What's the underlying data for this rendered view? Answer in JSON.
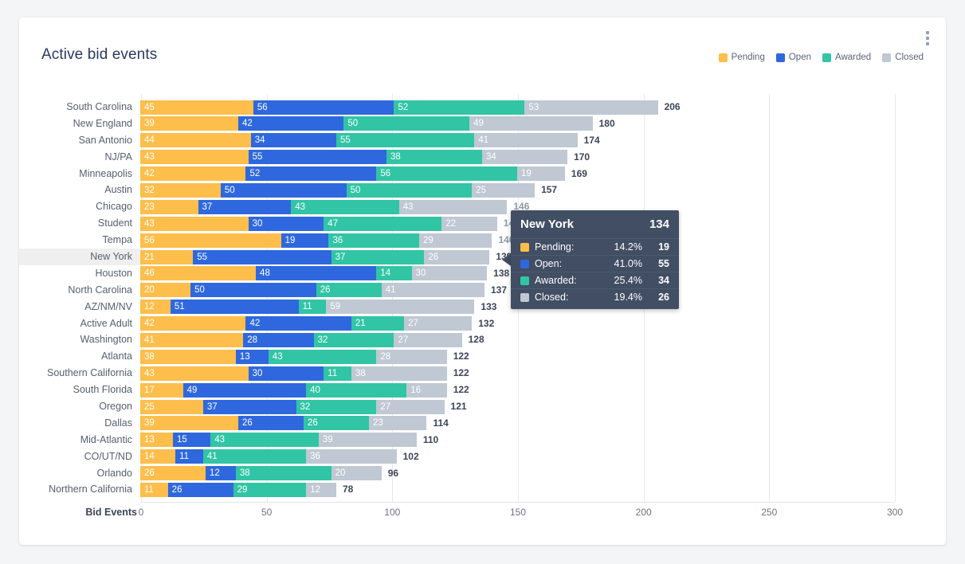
{
  "card": {
    "title": "Active bid events",
    "menu_icon": "kebab-menu-icon"
  },
  "legend": [
    {
      "label": "Pending",
      "color": "#fdbe4b"
    },
    {
      "label": "Open",
      "color": "#2f68de"
    },
    {
      "label": "Awarded",
      "color": "#31c5a5"
    },
    {
      "label": "Closed",
      "color": "#bfc8d3"
    }
  ],
  "tooltip": {
    "title": "New York",
    "total": "134",
    "rows": [
      {
        "name": "Pending:",
        "pct": "14.2%",
        "value": "19",
        "color": "#fdbe4b"
      },
      {
        "name": "Open:",
        "pct": "41.0%",
        "value": "55",
        "color": "#2f68de"
      },
      {
        "name": "Awarded:",
        "pct": "25.4%",
        "value": "34",
        "color": "#31c5a5"
      },
      {
        "name": "Closed:",
        "pct": "19.4%",
        "value": "26",
        "color": "#bfc8d3"
      }
    ]
  },
  "chart_data": {
    "type": "bar",
    "orientation": "horizontal",
    "stacked": true,
    "title": "Active bid events",
    "xlabel": "Bid Events",
    "ylabel": "",
    "xlim": [
      0,
      300
    ],
    "xticks": [
      "0",
      "50",
      "100",
      "150",
      "200",
      "250",
      "300"
    ],
    "grid": true,
    "legend_position": "top-right",
    "series": [
      {
        "name": "Pending",
        "color": "#fdbe4b"
      },
      {
        "name": "Open",
        "color": "#2f68de"
      },
      {
        "name": "Awarded",
        "color": "#31c5a5"
      },
      {
        "name": "Closed",
        "color": "#bfc8d3"
      }
    ],
    "categories": [
      "South Carolina",
      "New England",
      "San Antonio",
      "NJ/PA",
      "Minneapolis",
      "Austin",
      "Chicago",
      "Student",
      "Tempa",
      "New York",
      "Houston",
      "North Carolina",
      "AZ/NM/NV",
      "Active Adult",
      "Washington",
      "Atlanta",
      "Southern California",
      "South Florida",
      "Oregon",
      "Dallas",
      "Mid-Atlantic",
      "CO/UT/ND",
      "Orlando",
      "Northern California"
    ],
    "rows": [
      {
        "category": "South Carolina",
        "values": [
          45,
          56,
          52,
          53
        ],
        "total": "206",
        "highlight": false,
        "total_hidden": false
      },
      {
        "category": "New England",
        "values": [
          39,
          42,
          50,
          49
        ],
        "total": "180",
        "highlight": false,
        "total_hidden": false
      },
      {
        "category": "San Antonio",
        "values": [
          44,
          34,
          55,
          41
        ],
        "total": "174",
        "highlight": false,
        "total_hidden": false
      },
      {
        "category": "NJ/PA",
        "values": [
          43,
          55,
          38,
          34
        ],
        "total": "170",
        "highlight": false,
        "total_hidden": false
      },
      {
        "category": "Minneapolis",
        "values": [
          42,
          52,
          56,
          19
        ],
        "total": "169",
        "highlight": false,
        "total_hidden": false
      },
      {
        "category": "Austin",
        "values": [
          32,
          50,
          50,
          25
        ],
        "total": "157",
        "highlight": false,
        "total_hidden": false
      },
      {
        "category": "Chicago",
        "values": [
          23,
          37,
          43,
          43
        ],
        "total": "146",
        "highlight": false,
        "total_hidden": true
      },
      {
        "category": "Student",
        "values": [
          43,
          30,
          47,
          22
        ],
        "total": "142",
        "highlight": false,
        "total_hidden": true
      },
      {
        "category": "Tempa",
        "values": [
          56,
          19,
          36,
          29
        ],
        "total": "140",
        "highlight": false,
        "total_hidden": true
      },
      {
        "category": "New York",
        "values": [
          21,
          55,
          37,
          26
        ],
        "total": "139",
        "highlight": true,
        "total_hidden": false
      },
      {
        "category": "Houston",
        "values": [
          46,
          48,
          14,
          30
        ],
        "total": "138",
        "highlight": false,
        "total_hidden": false
      },
      {
        "category": "North Carolina",
        "values": [
          20,
          50,
          26,
          41
        ],
        "total": "137",
        "highlight": false,
        "total_hidden": false
      },
      {
        "category": "AZ/NM/NV",
        "values": [
          12,
          51,
          11,
          59
        ],
        "total": "133",
        "highlight": false,
        "total_hidden": false
      },
      {
        "category": "Active Adult",
        "values": [
          42,
          42,
          21,
          27
        ],
        "total": "132",
        "highlight": false,
        "total_hidden": false
      },
      {
        "category": "Washington",
        "values": [
          41,
          28,
          32,
          27
        ],
        "total": "128",
        "highlight": false,
        "total_hidden": false
      },
      {
        "category": "Atlanta",
        "values": [
          38,
          13,
          43,
          28
        ],
        "total": "122",
        "highlight": false,
        "total_hidden": false
      },
      {
        "category": "Southern California",
        "values": [
          43,
          30,
          11,
          38
        ],
        "total": "122",
        "highlight": false,
        "total_hidden": false
      },
      {
        "category": "South Florida",
        "values": [
          17,
          49,
          40,
          16
        ],
        "total": "122",
        "highlight": false,
        "total_hidden": false
      },
      {
        "category": "Oregon",
        "values": [
          25,
          37,
          32,
          27
        ],
        "total": "121",
        "highlight": false,
        "total_hidden": false
      },
      {
        "category": "Dallas",
        "values": [
          39,
          26,
          26,
          23
        ],
        "total": "114",
        "highlight": false,
        "total_hidden": false
      },
      {
        "category": "Mid-Atlantic",
        "values": [
          13,
          15,
          43,
          39
        ],
        "total": "110",
        "highlight": false,
        "total_hidden": false
      },
      {
        "category": "CO/UT/ND",
        "values": [
          14,
          11,
          41,
          36
        ],
        "total": "102",
        "highlight": false,
        "total_hidden": false
      },
      {
        "category": "Orlando",
        "values": [
          26,
          12,
          38,
          20
        ],
        "total": "96",
        "highlight": false,
        "total_hidden": false
      },
      {
        "category": "Northern California",
        "values": [
          11,
          26,
          29,
          12
        ],
        "total": "78",
        "highlight": false,
        "total_hidden": false
      }
    ]
  }
}
